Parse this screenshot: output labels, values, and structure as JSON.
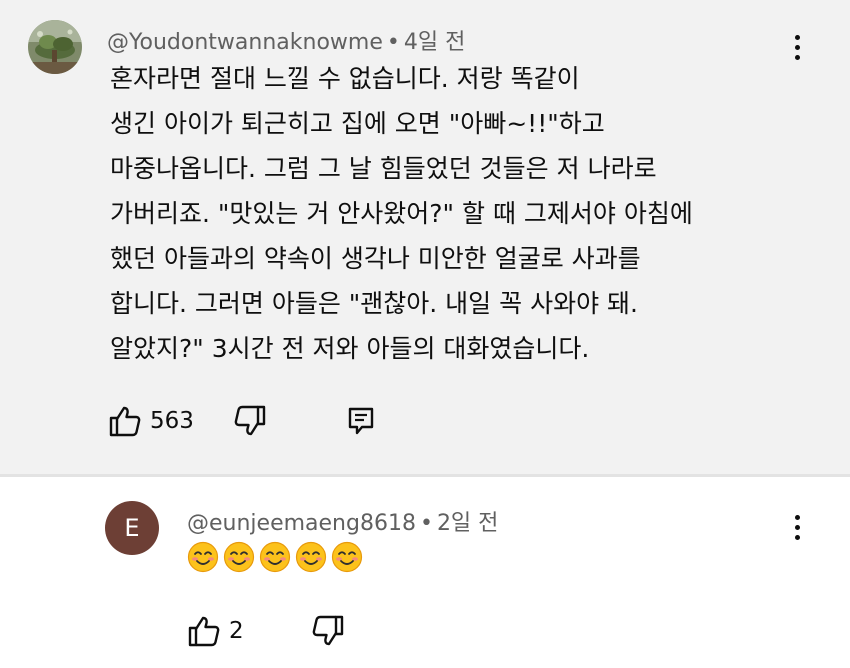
{
  "comment": {
    "username": "@Youdontwannaknowme",
    "age": "4일 전",
    "separator": "•",
    "lines": [
      "혼자라면 절대 느낄 수 없습니다. 저랑 똑같이",
      "생긴 아이가 퇴근히고 집에 오면 \"아빠~!!\"하고",
      "마중나옵니다. 그럼 그 날 힘들었던 것들은 저 나라로",
      "가버리죠. \"맛있는 거 안사왔어?\" 할 때 그제서야 아침에",
      "했던 아들과의 약속이 생각나 미안한 얼굴로 사과를",
      "합니다. 그러면 아들은 \"괜찮아. 내일 꼭 사와야 돼.",
      "알았지?\" 3시간 전 저와 아들의 대화였습니다."
    ],
    "like_count": "563",
    "icons": {
      "like": "thumbs-up-icon",
      "dislike": "thumbs-down-icon",
      "reply": "reply-icon",
      "more": "more-vert-icon"
    }
  },
  "reply": {
    "username": "@eunjeemaeng8618",
    "age": "2일 전",
    "separator": "•",
    "avatar_letter": "E",
    "avatar_color": "#6d3f35",
    "emoji": [
      "smiling-face",
      "smiling-face",
      "smiling-face",
      "smiling-face",
      "smiling-face"
    ],
    "like_count": "2"
  },
  "colors": {
    "top_background": "#f2f2f2",
    "text": "#0f0f0f",
    "meta_text": "#606060"
  }
}
